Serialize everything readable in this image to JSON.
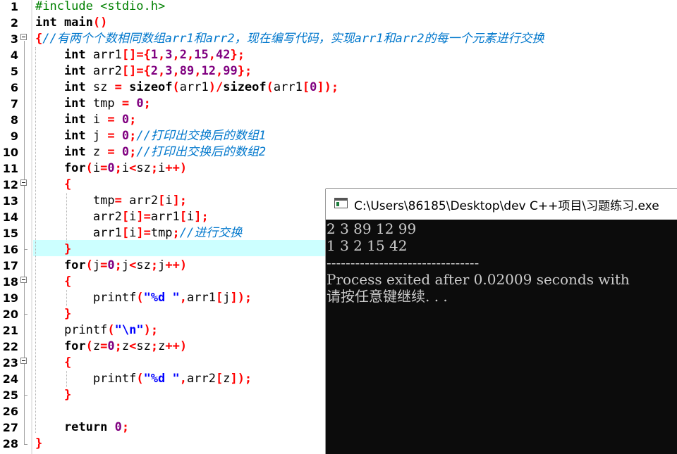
{
  "editor": {
    "line_numbers": [
      "1",
      "2",
      "3",
      "4",
      "5",
      "6",
      "7",
      "8",
      "9",
      "10",
      "11",
      "12",
      "13",
      "14",
      "15",
      "16",
      "17",
      "18",
      "19",
      "20",
      "21",
      "22",
      "23",
      "24",
      "25",
      "26",
      "27",
      "28"
    ],
    "comment_header": "//有两个个数相同数组arr1和arr2，现在编写代码，实现arr1和arr2的每一个元素进行交换",
    "comment_j": "//打印出交换后的数组1",
    "comment_z": "//打印出交换后的数组2",
    "comment_swap": "//进行交换",
    "include_line": "#include <stdio.h>"
  },
  "console": {
    "title": "C:\\Users\\86185\\Desktop\\dev C++项目\\习题练习.exe",
    "output_lines": [
      "2 3 89 12 99",
      "1 3 2 15 42",
      "--------------------------------",
      "Process exited after 0.02009 seconds with",
      "请按任意键继续. . ."
    ]
  }
}
